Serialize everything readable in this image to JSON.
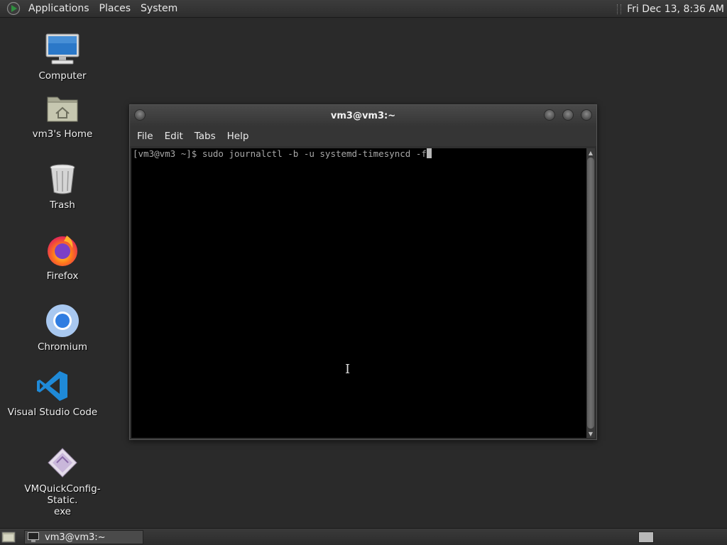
{
  "top_panel": {
    "menus": [
      "Applications",
      "Places",
      "System"
    ],
    "clock": "Fri Dec 13,  8:36 AM"
  },
  "desktop_icons": [
    {
      "label": "Computer",
      "icon": "computer-icon"
    },
    {
      "label": "vm3's Home",
      "icon": "home-folder-icon"
    },
    {
      "label": "Trash",
      "icon": "trash-icon"
    },
    {
      "label": "Firefox",
      "icon": "firefox-icon"
    },
    {
      "label": "Chromium",
      "icon": "chromium-icon"
    },
    {
      "label": "Visual Studio Code",
      "icon": "vscode-icon"
    },
    {
      "label": "VMQuickConfig-Static.\nexe",
      "icon": "installer-icon"
    }
  ],
  "terminal": {
    "title": "vm3@vm3:~",
    "menu": [
      "File",
      "Edit",
      "Tabs",
      "Help"
    ],
    "command_line": "[vm3@vm3 ~]$ sudo journalctl -b -u systemd-timesyncd -f"
  },
  "bottom_panel": {
    "task_label": "vm3@vm3:~"
  }
}
